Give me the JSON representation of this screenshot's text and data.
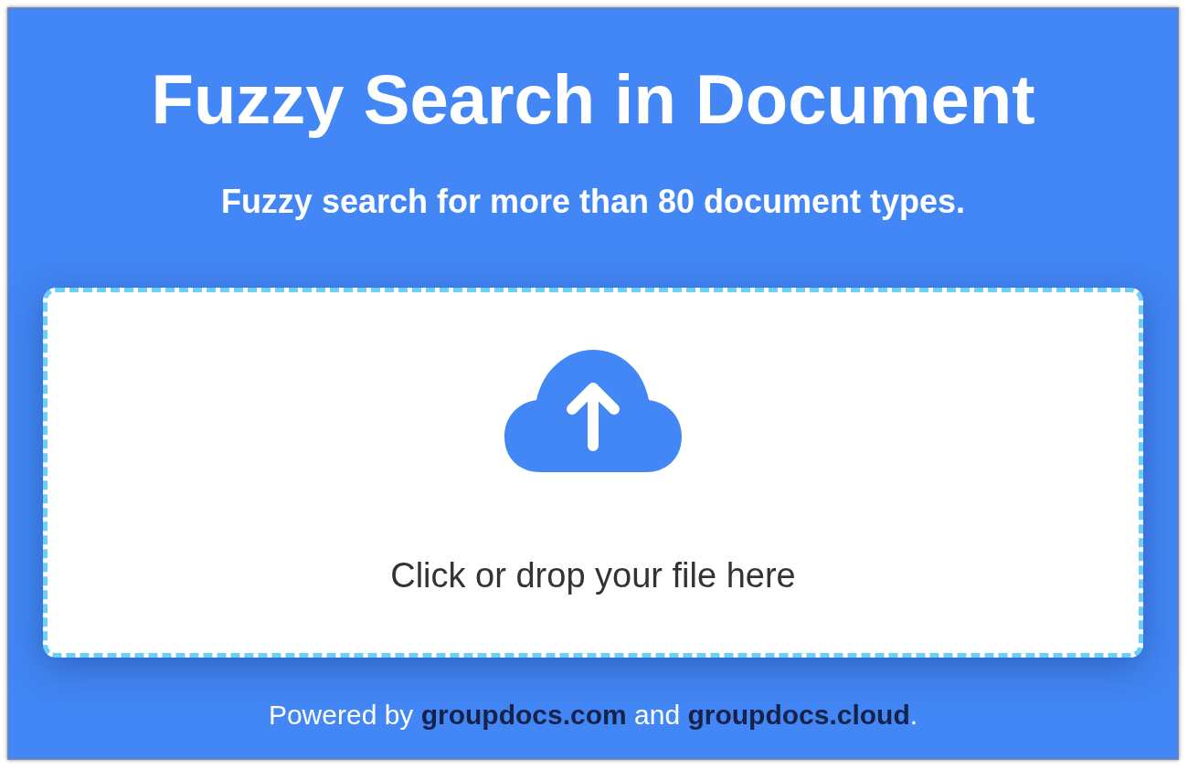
{
  "title": "Fuzzy Search in Document",
  "subtitle": "Fuzzy search for more than 80 document types.",
  "dropzone": {
    "label": "Click or drop your file here"
  },
  "footer": [
    {
      "kind": "text",
      "text": "Powered by "
    },
    {
      "kind": "link",
      "text": "groupdocs.com"
    },
    {
      "kind": "text",
      "text": " and "
    },
    {
      "kind": "link",
      "text": "groupdocs.cloud"
    },
    {
      "kind": "text",
      "text": "."
    }
  ]
}
